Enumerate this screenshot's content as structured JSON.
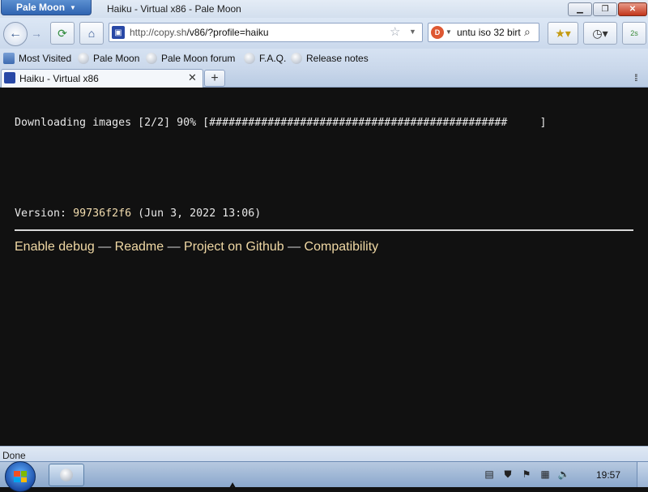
{
  "window": {
    "app_menu_label": "Pale Moon",
    "title": "Haiku - Virtual x86 - Pale Moon",
    "minimize_glyph": "▁",
    "maximize_glyph": "❐",
    "close_glyph": "✕"
  },
  "nav": {
    "back_icon": "arrow-left-icon",
    "forward_icon": "arrow-right-icon",
    "reload_icon": "reload-icon",
    "home_icon": "home-icon",
    "url_host": "http://copy.sh",
    "url_path": "/v86/?profile=haiku",
    "search_engine_label": "D",
    "search_query": "untu iso 32 birt",
    "addon_badge": "2s"
  },
  "bookmarks": [
    {
      "label": "Most Visited"
    },
    {
      "label": "Pale Moon"
    },
    {
      "label": "Pale Moon forum"
    },
    {
      "label": "F.A.Q."
    },
    {
      "label": "Release notes"
    }
  ],
  "tabs": [
    {
      "label": "Haiku - Virtual x86",
      "active": true
    }
  ],
  "page": {
    "download_line": "Downloading images [2/2] 90% [##############################################     ]",
    "version_label": "Version: ",
    "version_hash": "99736f2f6",
    "version_date": " (Jun 3, 2022 13:06)",
    "links": [
      "Enable debug",
      "Readme",
      "Project on Github",
      "Compatibility"
    ],
    "link_separator": " — "
  },
  "status": {
    "text": "Done"
  },
  "taskbar": {
    "clock": "19:57"
  },
  "colors": {
    "page_background": "#111111",
    "link_color": "#f0d8a4",
    "hash_color": "#f2dcae"
  }
}
